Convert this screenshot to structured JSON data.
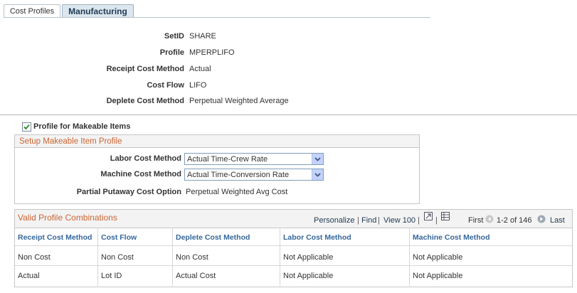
{
  "tabs": [
    {
      "label": "Cost Profiles"
    },
    {
      "label": "Manufacturing"
    }
  ],
  "header": {
    "fields": [
      {
        "label": "SetID",
        "value": "SHARE"
      },
      {
        "label": "Profile",
        "value": "MPERPLIFO"
      },
      {
        "label": "Receipt Cost Method",
        "value": "Actual"
      },
      {
        "label": "Cost Flow",
        "value": "LIFO"
      },
      {
        "label": "Deplete Cost Method",
        "value": "Perpetual Weighted Average"
      }
    ]
  },
  "makeable": {
    "checkbox_label": "Profile for Makeable Items",
    "checked": true,
    "group_title": "Setup Makeable Item Profile",
    "labor_label": "Labor Cost Method",
    "labor_value": "Actual Time-Crew Rate",
    "machine_label": "Machine Cost Method",
    "machine_value": "Actual Time-Conversion Rate",
    "partial_label": "Partial Putaway Cost Option",
    "partial_value": "Perpetual Weighted Avg Cost"
  },
  "grid": {
    "title": "Valid Profile Combinations",
    "personalize": "Personalize",
    "find": "Find",
    "view": "View 100",
    "first": "First",
    "range": "1-2 of 146",
    "last": "Last",
    "columns": [
      "Receipt Cost Method",
      "Cost Flow",
      "Deplete Cost Method",
      "Labor Cost Method",
      "Machine Cost Method"
    ],
    "rows": [
      [
        "Non Cost",
        "Non Cost",
        "Non Cost",
        "Not Applicable",
        "Not Applicable"
      ],
      [
        "Actual",
        "Lot ID",
        "Actual Cost",
        "Not Applicable",
        "Not Applicable"
      ]
    ]
  }
}
